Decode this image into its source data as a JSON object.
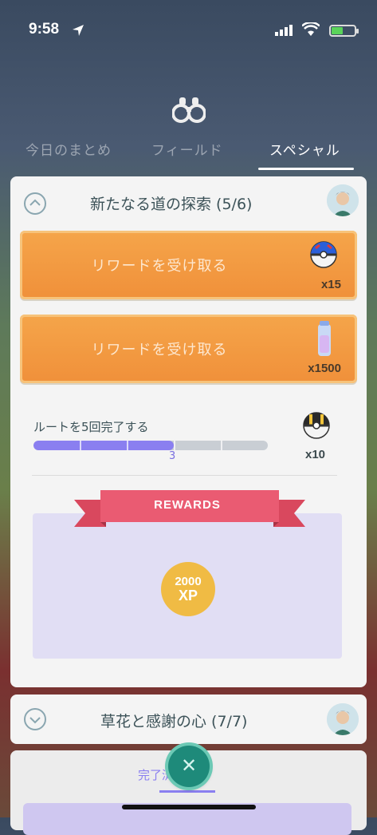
{
  "status_bar": {
    "time": "9:58"
  },
  "tabs": [
    {
      "label": "今日のまとめ"
    },
    {
      "label": "フィールド"
    },
    {
      "label": "スペシャル"
    }
  ],
  "quest_card": {
    "title": "新たなる道の探索 (5/6)",
    "rewards_buttons": [
      {
        "label": "リワードを受け取る",
        "quantity": "x15",
        "item_icon": "great-ball-icon"
      },
      {
        "label": "リワードを受け取る",
        "quantity": "x1500",
        "item_icon": "stardust-potion-icon"
      }
    ],
    "task": {
      "label": "ルートを5回完了する",
      "progress_value": "3",
      "progress_fraction": 0.6,
      "reward_quantity": "x10",
      "reward_icon": "ultra-ball-icon"
    },
    "rewards_banner": "REWARDS",
    "xp_reward": {
      "amount": "2000",
      "unit": "XP"
    }
  },
  "second_card": {
    "title": "草花と感謝の心 (7/7)"
  },
  "third_card": {
    "tab_label": "完了済み"
  },
  "colors": {
    "accent": "#8a7ff0",
    "orange_button": "#f0903a",
    "ribbon": "#e85a72"
  }
}
